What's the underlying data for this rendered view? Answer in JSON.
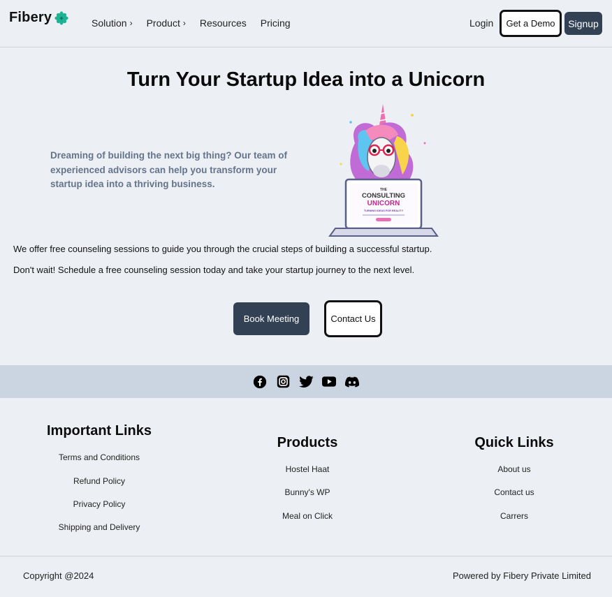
{
  "header": {
    "logo_text": "Fibery",
    "logo_icon": "flower-icon",
    "nav": [
      {
        "label": "Solution",
        "chevron": "›"
      },
      {
        "label": "Product",
        "chevron": "›"
      },
      {
        "label": "Resources",
        "chevron": ""
      },
      {
        "label": "Pricing",
        "chevron": ""
      }
    ],
    "login_label": "Login",
    "demo_label": "Get a Demo",
    "signup_label": "Signup"
  },
  "hero": {
    "title": "Turn Your Startup Idea into a Unicorn",
    "description": "Dreaming of building the next big thing? Our team of experienced advisors can help you transform your startup idea into a thriving business.",
    "image_text": {
      "line1": "THE",
      "line2": "CONSULTING",
      "line3": "UNICORN",
      "tagline": "TURNING IDEAS FOR REALITY"
    },
    "paragraph1": "We offer free counseling sessions to guide you through the crucial steps of building a successful startup.",
    "paragraph2": "Don't wait! Schedule a free counseling session today and take your startup journey to the next level.",
    "book_label": "Book Meeting",
    "contact_label": "Contact Us"
  },
  "social": [
    "facebook-icon",
    "instagram-icon",
    "twitter-icon",
    "youtube-icon",
    "discord-icon"
  ],
  "footer": {
    "important": {
      "title": "Important Links",
      "links": [
        "Terms and Conditions",
        "Refund Policy",
        "Privacy Policy",
        "Shipping and Delivery"
      ]
    },
    "products": {
      "title": "Products",
      "links": [
        "Hostel Haat",
        "Bunny's WP",
        "Meal on Click"
      ]
    },
    "quick": {
      "title": "Quick Links",
      "links": [
        "About us",
        "Contact us",
        "Carrers"
      ]
    },
    "copyright": "Copyright @2024",
    "powered": "Powered by Fibery Private Limited"
  },
  "colors": {
    "background": "#eceff3",
    "primary": "#334155",
    "muted_text": "#64748b",
    "social_band": "#cbd4e1",
    "logo_accent": "#1bb394"
  }
}
